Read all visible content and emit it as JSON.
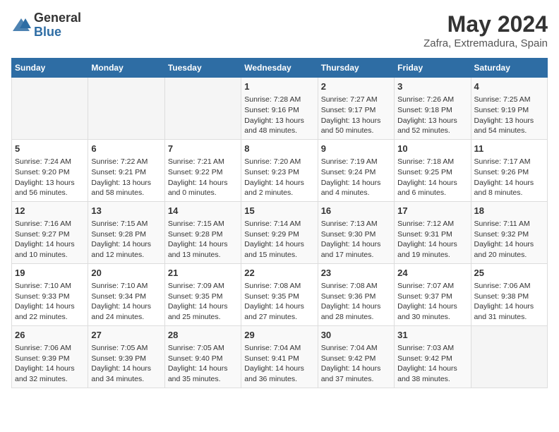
{
  "header": {
    "logo_general": "General",
    "logo_blue": "Blue",
    "month_year": "May 2024",
    "location": "Zafra, Extremadura, Spain"
  },
  "days_of_week": [
    "Sunday",
    "Monday",
    "Tuesday",
    "Wednesday",
    "Thursday",
    "Friday",
    "Saturday"
  ],
  "weeks": [
    [
      {
        "day": "",
        "info": ""
      },
      {
        "day": "",
        "info": ""
      },
      {
        "day": "",
        "info": ""
      },
      {
        "day": "1",
        "info": "Sunrise: 7:28 AM\nSunset: 9:16 PM\nDaylight: 13 hours and 48 minutes."
      },
      {
        "day": "2",
        "info": "Sunrise: 7:27 AM\nSunset: 9:17 PM\nDaylight: 13 hours and 50 minutes."
      },
      {
        "day": "3",
        "info": "Sunrise: 7:26 AM\nSunset: 9:18 PM\nDaylight: 13 hours and 52 minutes."
      },
      {
        "day": "4",
        "info": "Sunrise: 7:25 AM\nSunset: 9:19 PM\nDaylight: 13 hours and 54 minutes."
      }
    ],
    [
      {
        "day": "5",
        "info": "Sunrise: 7:24 AM\nSunset: 9:20 PM\nDaylight: 13 hours and 56 minutes."
      },
      {
        "day": "6",
        "info": "Sunrise: 7:22 AM\nSunset: 9:21 PM\nDaylight: 13 hours and 58 minutes."
      },
      {
        "day": "7",
        "info": "Sunrise: 7:21 AM\nSunset: 9:22 PM\nDaylight: 14 hours and 0 minutes."
      },
      {
        "day": "8",
        "info": "Sunrise: 7:20 AM\nSunset: 9:23 PM\nDaylight: 14 hours and 2 minutes."
      },
      {
        "day": "9",
        "info": "Sunrise: 7:19 AM\nSunset: 9:24 PM\nDaylight: 14 hours and 4 minutes."
      },
      {
        "day": "10",
        "info": "Sunrise: 7:18 AM\nSunset: 9:25 PM\nDaylight: 14 hours and 6 minutes."
      },
      {
        "day": "11",
        "info": "Sunrise: 7:17 AM\nSunset: 9:26 PM\nDaylight: 14 hours and 8 minutes."
      }
    ],
    [
      {
        "day": "12",
        "info": "Sunrise: 7:16 AM\nSunset: 9:27 PM\nDaylight: 14 hours and 10 minutes."
      },
      {
        "day": "13",
        "info": "Sunrise: 7:15 AM\nSunset: 9:28 PM\nDaylight: 14 hours and 12 minutes."
      },
      {
        "day": "14",
        "info": "Sunrise: 7:15 AM\nSunset: 9:28 PM\nDaylight: 14 hours and 13 minutes."
      },
      {
        "day": "15",
        "info": "Sunrise: 7:14 AM\nSunset: 9:29 PM\nDaylight: 14 hours and 15 minutes."
      },
      {
        "day": "16",
        "info": "Sunrise: 7:13 AM\nSunset: 9:30 PM\nDaylight: 14 hours and 17 minutes."
      },
      {
        "day": "17",
        "info": "Sunrise: 7:12 AM\nSunset: 9:31 PM\nDaylight: 14 hours and 19 minutes."
      },
      {
        "day": "18",
        "info": "Sunrise: 7:11 AM\nSunset: 9:32 PM\nDaylight: 14 hours and 20 minutes."
      }
    ],
    [
      {
        "day": "19",
        "info": "Sunrise: 7:10 AM\nSunset: 9:33 PM\nDaylight: 14 hours and 22 minutes."
      },
      {
        "day": "20",
        "info": "Sunrise: 7:10 AM\nSunset: 9:34 PM\nDaylight: 14 hours and 24 minutes."
      },
      {
        "day": "21",
        "info": "Sunrise: 7:09 AM\nSunset: 9:35 PM\nDaylight: 14 hours and 25 minutes."
      },
      {
        "day": "22",
        "info": "Sunrise: 7:08 AM\nSunset: 9:35 PM\nDaylight: 14 hours and 27 minutes."
      },
      {
        "day": "23",
        "info": "Sunrise: 7:08 AM\nSunset: 9:36 PM\nDaylight: 14 hours and 28 minutes."
      },
      {
        "day": "24",
        "info": "Sunrise: 7:07 AM\nSunset: 9:37 PM\nDaylight: 14 hours and 30 minutes."
      },
      {
        "day": "25",
        "info": "Sunrise: 7:06 AM\nSunset: 9:38 PM\nDaylight: 14 hours and 31 minutes."
      }
    ],
    [
      {
        "day": "26",
        "info": "Sunrise: 7:06 AM\nSunset: 9:39 PM\nDaylight: 14 hours and 32 minutes."
      },
      {
        "day": "27",
        "info": "Sunrise: 7:05 AM\nSunset: 9:39 PM\nDaylight: 14 hours and 34 minutes."
      },
      {
        "day": "28",
        "info": "Sunrise: 7:05 AM\nSunset: 9:40 PM\nDaylight: 14 hours and 35 minutes."
      },
      {
        "day": "29",
        "info": "Sunrise: 7:04 AM\nSunset: 9:41 PM\nDaylight: 14 hours and 36 minutes."
      },
      {
        "day": "30",
        "info": "Sunrise: 7:04 AM\nSunset: 9:42 PM\nDaylight: 14 hours and 37 minutes."
      },
      {
        "day": "31",
        "info": "Sunrise: 7:03 AM\nSunset: 9:42 PM\nDaylight: 14 hours and 38 minutes."
      },
      {
        "day": "",
        "info": ""
      }
    ]
  ]
}
